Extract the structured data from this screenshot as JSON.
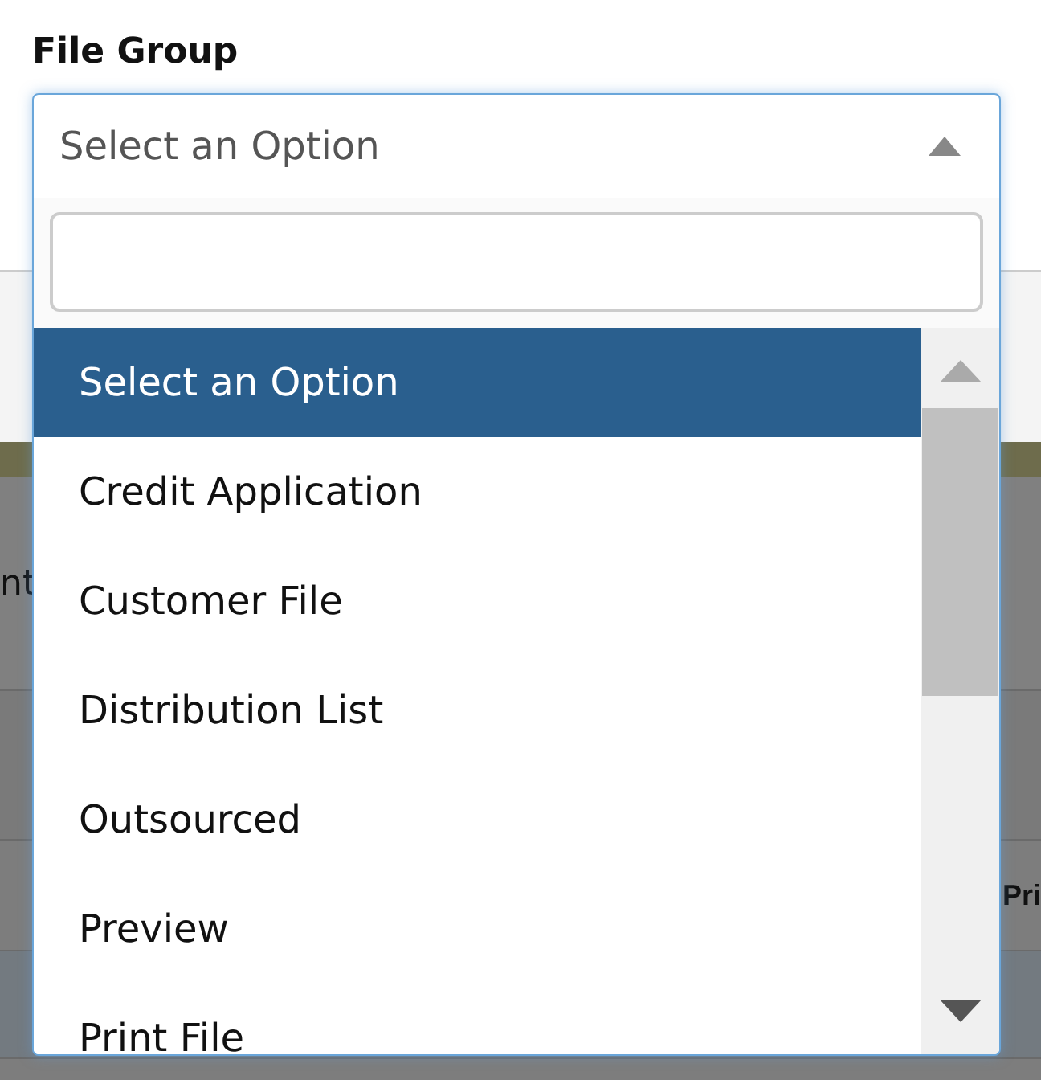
{
  "background": {
    "left_fragment": "nt",
    "right_fragment": "Pri"
  },
  "field": {
    "label": "File Group",
    "value": "Select an Option",
    "expanded": true
  },
  "options": [
    {
      "label": "Select an Option",
      "selected": true
    },
    {
      "label": "Credit Application",
      "selected": false
    },
    {
      "label": "Customer File",
      "selected": false
    },
    {
      "label": "Distribution List",
      "selected": false
    },
    {
      "label": "Outsourced",
      "selected": false
    },
    {
      "label": "Preview",
      "selected": false
    },
    {
      "label": "Print File",
      "selected": false
    }
  ]
}
